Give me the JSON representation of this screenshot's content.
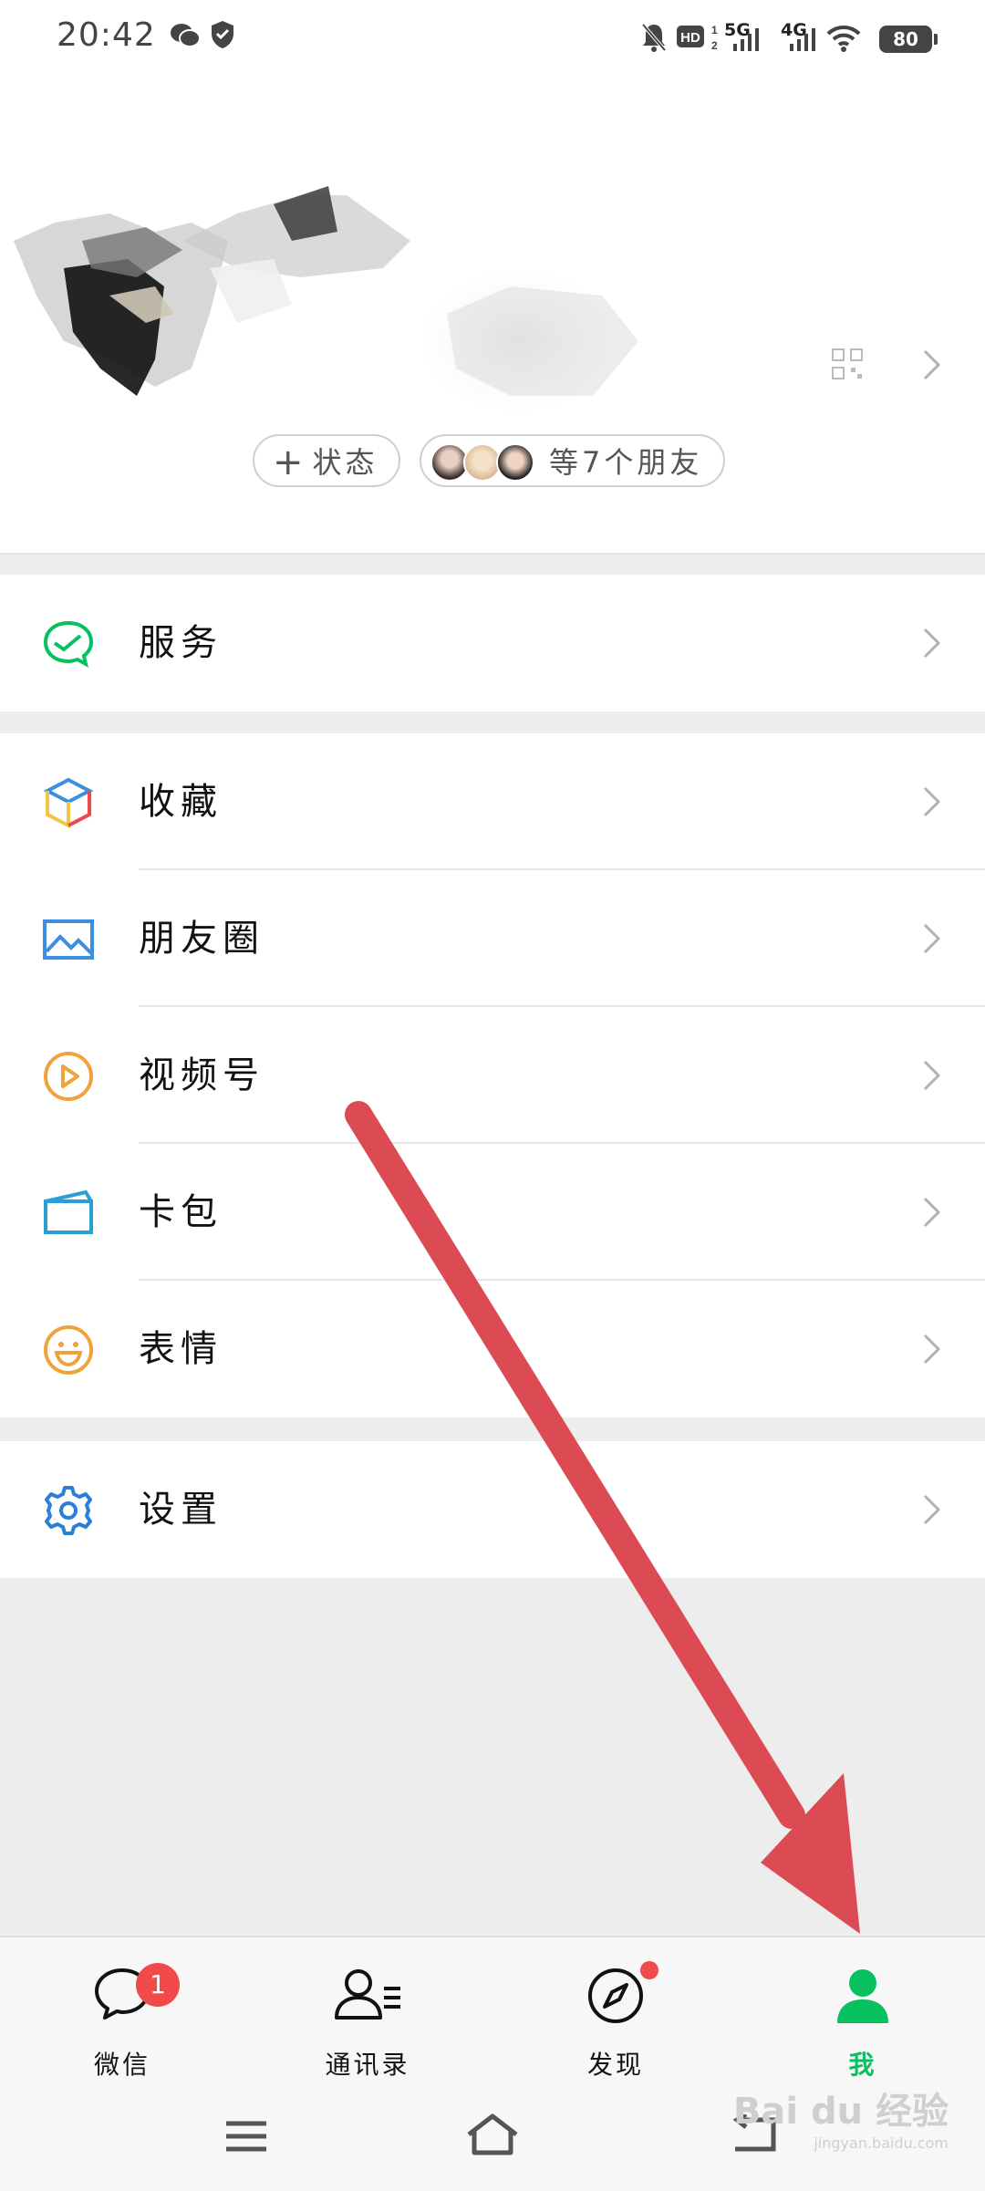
{
  "status_bar": {
    "time": "20:42",
    "network_1": "5G",
    "network_2": "4G",
    "battery": "80"
  },
  "profile": {
    "status_button": "状态",
    "friends_label": "等7个朋友"
  },
  "menu": {
    "service": "服务",
    "favorites": "收藏",
    "moments": "朋友圈",
    "channels": "视频号",
    "cards": "卡包",
    "stickers": "表情",
    "settings": "设置"
  },
  "tabs": [
    {
      "label": "微信",
      "badge": "1"
    },
    {
      "label": "通讯录"
    },
    {
      "label": "发现"
    },
    {
      "label": "我"
    }
  ],
  "colors": {
    "accent_green": "#07c160",
    "badge_red": "#f14a4a",
    "annotation_arrow": "#dc4b53"
  },
  "watermark": {
    "text": "Bai du 经验",
    "url": "jingyan.baidu.com"
  }
}
